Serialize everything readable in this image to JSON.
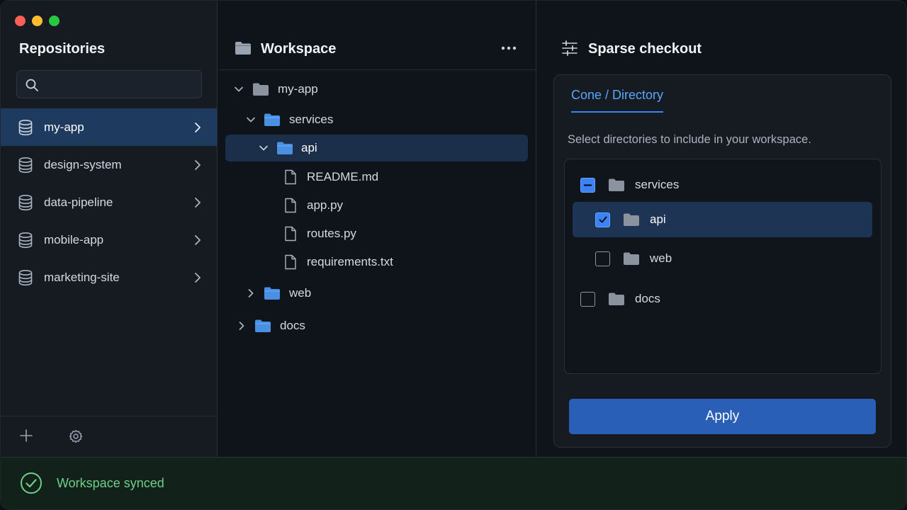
{
  "sidebar": {
    "title": "Repositories",
    "search_placeholder": "",
    "repos": [
      {
        "label": "my-app",
        "active": true
      },
      {
        "label": "design-system",
        "active": false
      },
      {
        "label": "data-pipeline",
        "active": false
      },
      {
        "label": "mobile-app",
        "active": false
      },
      {
        "label": "marketing-site",
        "active": false
      }
    ],
    "icons": {
      "add": "plus-icon",
      "settings": "gear-icon",
      "repo": "database-icon",
      "search": "search-icon"
    }
  },
  "workspace": {
    "title": "Workspace",
    "tree": {
      "root": "my-app",
      "services": "services",
      "api": "api",
      "files": [
        "README.md",
        "app.py",
        "routes.py",
        "requirements.txt"
      ],
      "web": "web",
      "docs": "docs"
    }
  },
  "sparse": {
    "title": "Sparse checkout",
    "tab": "Cone / Directory",
    "description": "Select directories to include in your workspace.",
    "dirs": {
      "services": {
        "label": "services",
        "state": "partial"
      },
      "api": {
        "label": "api",
        "state": "checked"
      },
      "web": {
        "label": "web",
        "state": "unchecked"
      },
      "docs": {
        "label": "docs",
        "state": "unchecked"
      }
    },
    "apply_label": "Apply"
  },
  "status": {
    "message": "Workspace synced"
  },
  "colors": {
    "accent": "#3b82f6",
    "folder_blue": "#4a90e2",
    "success": "#6fcf86",
    "active_row": "#1e3a5f"
  }
}
